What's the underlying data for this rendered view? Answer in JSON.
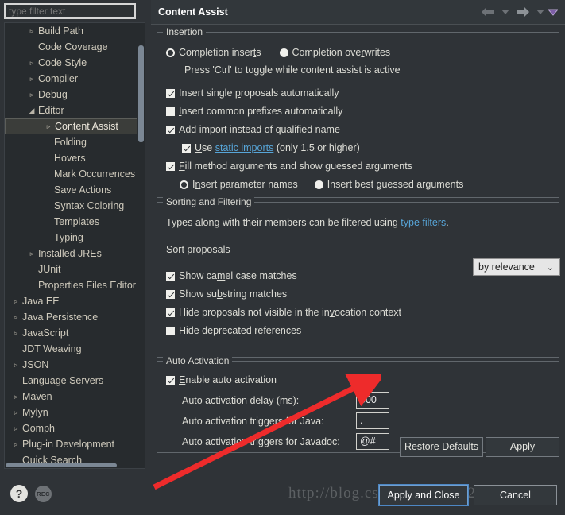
{
  "sidebar": {
    "filter": {
      "value": "",
      "placeholder": "type filter text"
    },
    "items": [
      {
        "label": "Build Path",
        "indent": 1,
        "twisty": "collapsed"
      },
      {
        "label": "Code Coverage",
        "indent": 1,
        "twisty": "none"
      },
      {
        "label": "Code Style",
        "indent": 1,
        "twisty": "collapsed"
      },
      {
        "label": "Compiler",
        "indent": 1,
        "twisty": "collapsed"
      },
      {
        "label": "Debug",
        "indent": 1,
        "twisty": "collapsed"
      },
      {
        "label": "Editor",
        "indent": 1,
        "twisty": "expanded"
      },
      {
        "label": "Content Assist",
        "indent": 2,
        "twisty": "collapsed",
        "selected": true
      },
      {
        "label": "Folding",
        "indent": 2,
        "twisty": "none"
      },
      {
        "label": "Hovers",
        "indent": 2,
        "twisty": "none"
      },
      {
        "label": "Mark Occurrences",
        "indent": 2,
        "twisty": "none"
      },
      {
        "label": "Save Actions",
        "indent": 2,
        "twisty": "none"
      },
      {
        "label": "Syntax Coloring",
        "indent": 2,
        "twisty": "none"
      },
      {
        "label": "Templates",
        "indent": 2,
        "twisty": "none"
      },
      {
        "label": "Typing",
        "indent": 2,
        "twisty": "none"
      },
      {
        "label": "Installed JREs",
        "indent": 1,
        "twisty": "collapsed"
      },
      {
        "label": "JUnit",
        "indent": 1,
        "twisty": "none"
      },
      {
        "label": "Properties Files Editor",
        "indent": 1,
        "twisty": "none"
      },
      {
        "label": "Java EE",
        "indent": 0,
        "twisty": "collapsed"
      },
      {
        "label": "Java Persistence",
        "indent": 0,
        "twisty": "collapsed"
      },
      {
        "label": "JavaScript",
        "indent": 0,
        "twisty": "collapsed"
      },
      {
        "label": "JDT Weaving",
        "indent": 0,
        "twisty": "none"
      },
      {
        "label": "JSON",
        "indent": 0,
        "twisty": "collapsed"
      },
      {
        "label": "Language Servers",
        "indent": 0,
        "twisty": "none"
      },
      {
        "label": "Maven",
        "indent": 0,
        "twisty": "collapsed"
      },
      {
        "label": "Mylyn",
        "indent": 0,
        "twisty": "collapsed"
      },
      {
        "label": "Oomph",
        "indent": 0,
        "twisty": "collapsed"
      },
      {
        "label": "Plug-in Development",
        "indent": 0,
        "twisty": "collapsed"
      },
      {
        "label": "Quick Search",
        "indent": 0,
        "twisty": "none"
      }
    ]
  },
  "titlebar": {
    "title": "Content Assist",
    "back_icon": "back-arrow-icon",
    "back_dropdown_icon": "chevron-down-icon",
    "forward_icon": "forward-arrow-icon",
    "forward_dropdown_icon": "chevron-down-icon",
    "menu_icon": "view-menu-icon"
  },
  "insertion": {
    "legend": "Insertion",
    "radio_inserts": {
      "label": "Completion inser",
      "accel": "t",
      "tail": "s",
      "selected": true
    },
    "radio_overwrites": {
      "label": "Completion ove",
      "accel": "r",
      "tail": "writes",
      "selected": false
    },
    "hint": "Press 'Ctrl' to toggle while content assist is active",
    "checkboxes": [
      {
        "pre": "Insert single ",
        "accel": "p",
        "post": "roposals automatically",
        "checked": true
      },
      {
        "pre": "",
        "accel": "I",
        "post": "nsert common prefixes automatically",
        "checked": false
      },
      {
        "pre": "Add import instead of qua",
        "accel": "l",
        "post": "ified name",
        "checked": true
      }
    ],
    "static_imports": {
      "pre": "",
      "accel": "U",
      "mid": "se ",
      "link": "static imports",
      "post": " (only 1.5 or higher)",
      "checked": true
    },
    "fill_args": {
      "pre": "",
      "accel": "F",
      "post": "ill method arguments and show guessed arguments",
      "checked": true
    },
    "radio_param_names": {
      "pre": "I",
      "accel": "n",
      "post": "sert parameter names",
      "selected": true
    },
    "radio_best_guessed": {
      "pre": "Insert best ",
      "accel": "g",
      "post": "uessed arguments",
      "selected": false
    }
  },
  "sorting": {
    "legend": "Sorting and Filtering",
    "description_pre": "Types along with their members can be filtered using ",
    "description_link": "type filters",
    "description_post": ".",
    "sort_label": "Sort proposals",
    "sort_value": "by relevance",
    "sort_chevron_icon": "chevron-down-icon",
    "checkboxes": [
      {
        "pre": "Show ca",
        "accel": "m",
        "post": "el case matches",
        "checked": true
      },
      {
        "pre": "Show su",
        "accel": "b",
        "post": "string matches",
        "checked": true
      },
      {
        "pre": "Hide proposals not visible in the in",
        "accel": "v",
        "post": "ocation context",
        "checked": true
      },
      {
        "pre": "",
        "accel": "H",
        "post": "ide deprecated references",
        "checked": false
      }
    ]
  },
  "auto_activation": {
    "legend": "Auto Activation",
    "enable": {
      "pre": "",
      "accel": "E",
      "post": "nable auto activation",
      "checked": true
    },
    "fields": [
      {
        "label": "Auto activation delay (ms):",
        "value": "500"
      },
      {
        "label": "Auto activation triggers for Java:",
        "value": "."
      },
      {
        "label": "Auto activation triggers for Javadoc:",
        "value": "@#"
      }
    ]
  },
  "buttons": {
    "restore_pre": "Restore ",
    "restore_accel": "D",
    "restore_post": "efaults",
    "apply_pre": "",
    "apply_accel": "A",
    "apply_post": "pply",
    "apply_and_close": "Apply and Close",
    "cancel": "Cancel"
  },
  "footer": {
    "help_icon_glyph": "?",
    "rec_badge": "REC"
  },
  "watermark": "http://blog.csdn.net/qq_19260029",
  "annotation": {
    "arrow_color": "#ee2b2b"
  },
  "colors": {
    "window_bg": "#2f3337",
    "tree_bg": "#272b2e",
    "selection_bg": "#3b3d3a",
    "link": "#57a5d8",
    "focus_border": "#6f9fd0",
    "combo_bg": "#e6e6e6"
  }
}
